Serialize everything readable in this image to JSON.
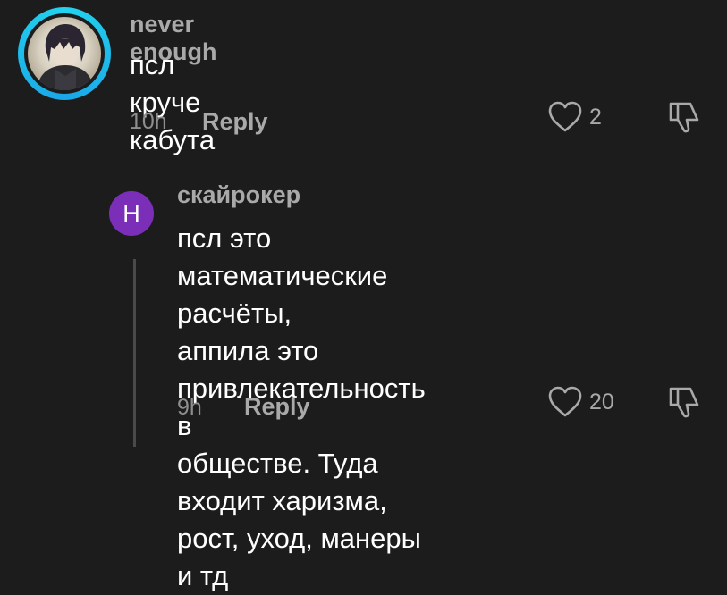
{
  "comments": [
    {
      "username": "never enough",
      "text": "псл круче кабута",
      "time": "10h",
      "reply_label": "Reply",
      "likes": "2",
      "avatar_type": "photo",
      "ring_color": "#22d3ee"
    }
  ],
  "replies": [
    {
      "username": "скайрокер",
      "avatar_letter": "Н",
      "avatar_color": "#7b2fb8",
      "text": "псл это математические расчёты,\nаппила это привлекательность в\nобществе. Туда входит харизма,\nрост, уход, манеры и тд",
      "time": "9h",
      "reply_label": "Reply",
      "likes": "20"
    }
  ],
  "icons": {
    "like": "heart-outline-icon",
    "dislike": "thumbs-down-outline-icon"
  }
}
